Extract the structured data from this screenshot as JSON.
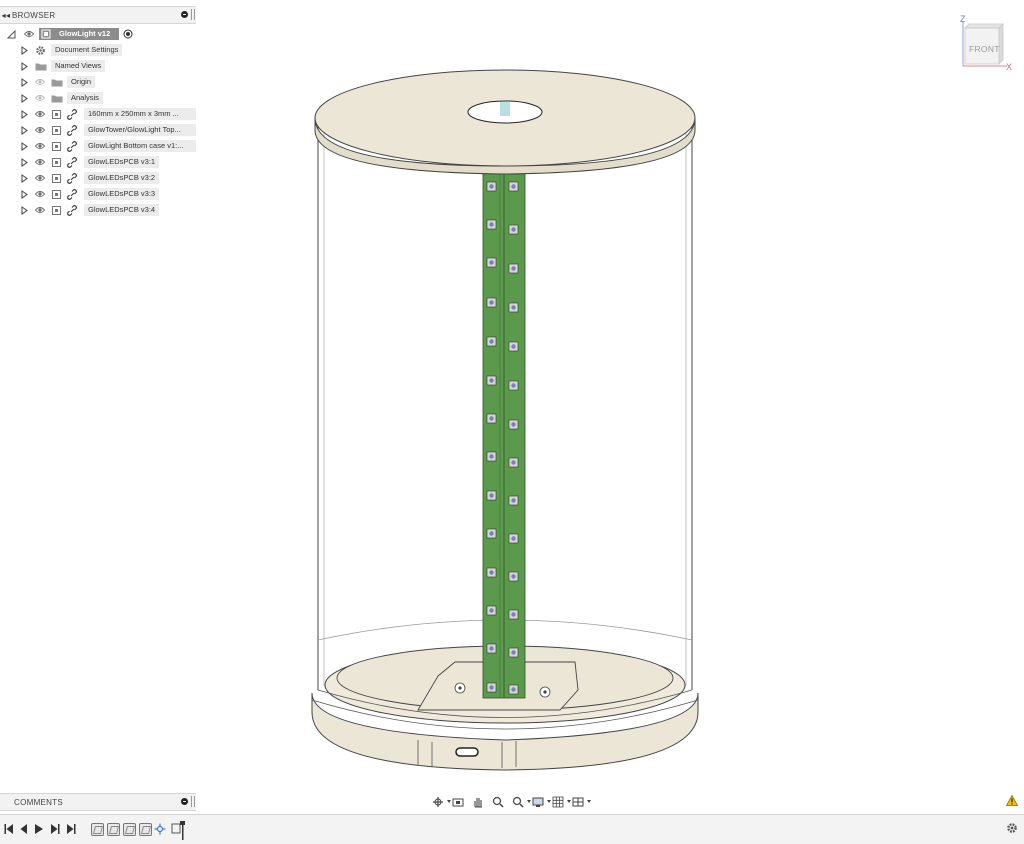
{
  "browser": {
    "title": "BROWSER",
    "root": "GlowLight v12",
    "items": [
      {
        "label": "Document Settings"
      },
      {
        "label": "Named Views"
      },
      {
        "label": "Origin"
      },
      {
        "label": "Analysis"
      },
      {
        "label": "160mm x 250mm x 3mm ..."
      },
      {
        "label": "GlowTower/GlowLight Top..."
      },
      {
        "label": "GlowLight Bottom case v1:..."
      },
      {
        "label": "GlowLEDsPCB v3:1"
      },
      {
        "label": "GlowLEDsPCB v3:2"
      },
      {
        "label": "GlowLEDsPCB v3:3"
      },
      {
        "label": "GlowLEDsPCB v3:4"
      }
    ]
  },
  "comments": {
    "title": "COMMENTS"
  },
  "viewcube": {
    "face": "FRONT",
    "axis_z": "Z",
    "axis_x": "X"
  },
  "colors": {
    "pcb_green": "#5b9a4d",
    "case_beige": "#ebe6d6",
    "accent_warning": "#f2c200"
  },
  "icons": {
    "nav": [
      "orbit-icon",
      "look-at-icon",
      "pan-icon",
      "zoom-icon",
      "fit-icon",
      "display-settings-icon",
      "grid-icon",
      "viewports-icon"
    ],
    "timeline": [
      "go-to-start-icon",
      "step-back-icon",
      "play-icon",
      "step-forward-icon",
      "go-to-end-icon"
    ]
  }
}
